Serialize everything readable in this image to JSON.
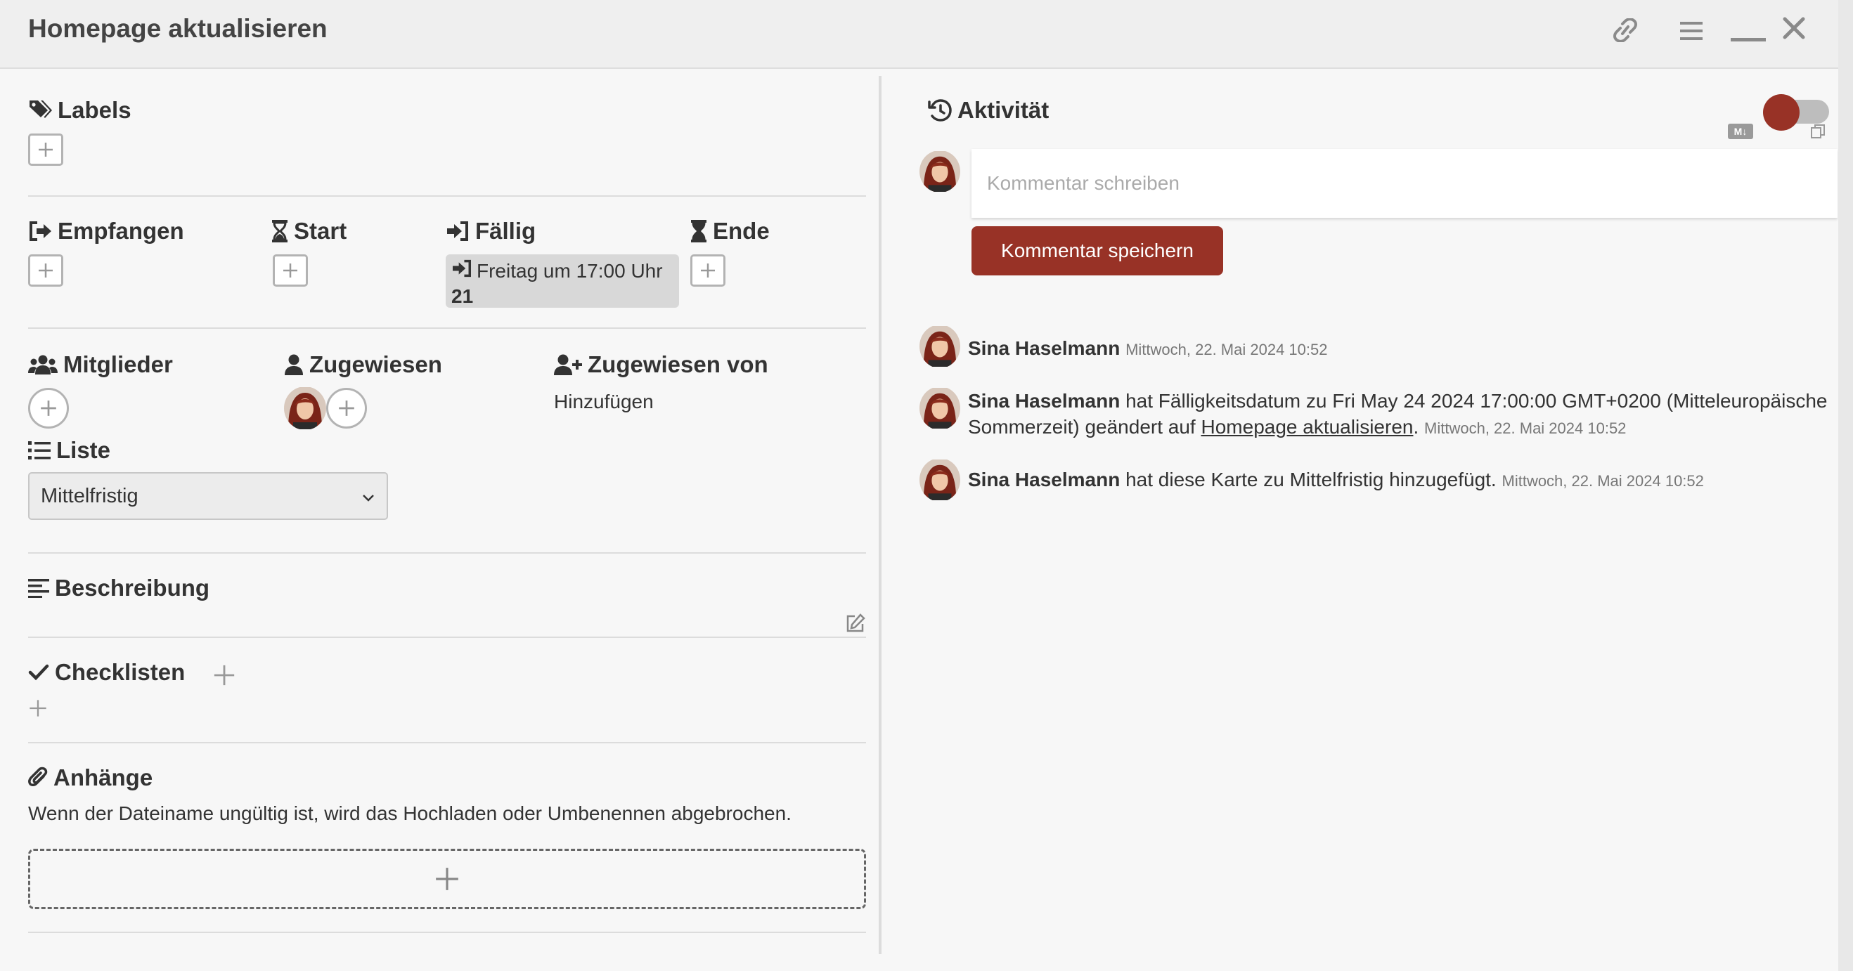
{
  "header": {
    "title": "Homepage aktualisieren"
  },
  "sections": {
    "labels": "Labels",
    "received": "Empfangen",
    "start": "Start",
    "due": "Fällig",
    "end": "Ende",
    "members": "Mitglieder",
    "assigned": "Zugewiesen",
    "assigned_by": "Zugewiesen von",
    "list": "Liste",
    "description": "Beschreibung",
    "checklists": "Checklisten",
    "attachments": "Anhänge"
  },
  "due": {
    "line1": "Freitag um 17:00 Uhr",
    "line2": "21"
  },
  "assigned_by_action": "Hinzufügen",
  "list": {
    "selected": "Mittelfristig"
  },
  "attachments": {
    "note": "Wenn der Dateiname ungültig ist, wird das Hochladen oder Umbenennen abgebrochen."
  },
  "activity": {
    "title": "Aktivität",
    "markdown_badge": "M↓",
    "comment_placeholder": "Kommentar schreiben",
    "save_label": "Kommentar speichern",
    "items": [
      {
        "user": "Sina Haselmann",
        "text": "",
        "timestamp": "Mittwoch, 22. Mai 2024 10:52"
      },
      {
        "user": "Sina Haselmann",
        "text_before": "hat Fälligkeitsdatum zu Fri May 24 2024 17:00:00 GMT+0200 (Mitteleuropäische",
        "text_line2": "Sommerzeit) geändert auf",
        "link": "Homepage aktualisieren",
        "timestamp": "Mittwoch, 22. Mai 2024 10:52"
      },
      {
        "user": "Sina Haselmann",
        "text": "hat diese Karte zu Mittelfristig hinzugefügt.",
        "timestamp": "Mittwoch, 22. Mai 2024 10:52"
      }
    ]
  },
  "colors": {
    "accent": "#983226",
    "header_bg": "#efefef",
    "panel_bg": "#f7f7f7"
  }
}
